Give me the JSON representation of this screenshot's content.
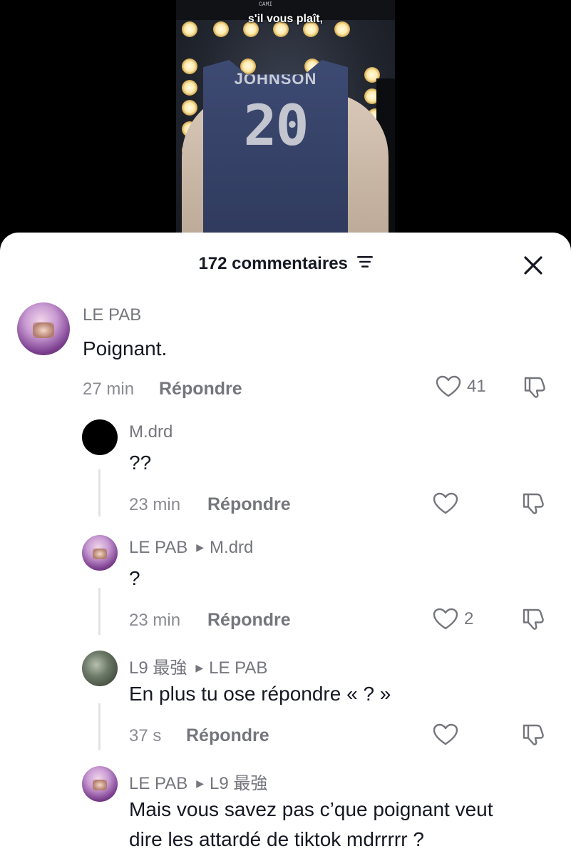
{
  "video": {
    "subtitle": "s'il vous plaît,",
    "corner_text": "CAMI",
    "jersey_name": "JOHNSON",
    "jersey_number": "20"
  },
  "sheet": {
    "title": "172 commentaires",
    "sort_icon": "sort-icon",
    "close_icon": "close-icon"
  },
  "comments": [
    {
      "username": "LE PAB",
      "reply_to": "",
      "text": "Poignant.",
      "time": "27 min",
      "reply_label": "Répondre",
      "likes": "41"
    },
    {
      "username": "M.drd",
      "reply_to": "",
      "text": "??",
      "time": "23 min",
      "reply_label": "Répondre",
      "likes": ""
    },
    {
      "username": "LE PAB",
      "reply_to": "M.drd",
      "text": "?",
      "time": "23 min",
      "reply_label": "Répondre",
      "likes": "2"
    },
    {
      "username": "L9 最強",
      "reply_to": "LE PAB",
      "text": "En plus tu ose répondre « ? »",
      "time": "37 s",
      "reply_label": "Répondre",
      "likes": ""
    },
    {
      "username": "LE PAB",
      "reply_to": "L9 最強",
      "text_line1": "Mais vous savez pas c’que poignant veut",
      "text_line2": "dire les attardé de tiktok mdrrrrr ?"
    }
  ],
  "colors": {
    "text_primary": "#161823",
    "text_secondary": "#75767d",
    "sheet_bg": "#ffffff"
  }
}
